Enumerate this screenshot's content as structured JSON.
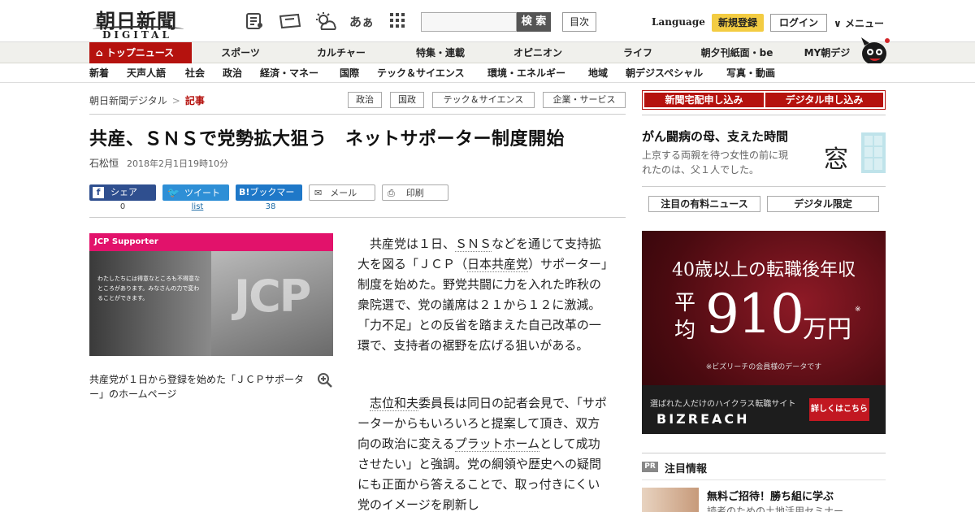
{
  "header": {
    "logo_jp": "朝日新聞",
    "logo_en": "DIGITAL",
    "font_size_label": "あぁ",
    "search_button": "検 索",
    "toc_button": "目次",
    "language": "Language",
    "register": "新規登録",
    "login": "ログイン",
    "menu": "メニュー"
  },
  "nav1": {
    "top": "トップニュース",
    "items": [
      "スポーツ",
      "カルチャー",
      "特集・連載",
      "オピニオン",
      "ライフ",
      "朝夕刊紙面・be",
      "MY朝デジ"
    ]
  },
  "nav2": {
    "items": [
      "新着",
      "天声人語",
      "社会",
      "政治",
      "経済・マネー",
      "国際",
      "テック＆サイエンス",
      "環境・エネルギー",
      "地域",
      "朝デジスペシャル",
      "写真・動画"
    ]
  },
  "breadcrumb": {
    "home": "朝日新聞デジタル",
    "sep": ">",
    "current": "記事"
  },
  "tags": [
    "政治",
    "国政",
    "テック＆サイエンス",
    "企業・サービス"
  ],
  "article": {
    "headline": "共産、ＳＮＳで党勢拡大狙う　ネットサポーター制度開始",
    "author": "石松恒",
    "date": "2018年2月1日19時10分",
    "share": {
      "facebook": "シェア",
      "facebook_count": "0",
      "twitter": "ツイート",
      "twitter_count": "list",
      "hatena": "ブックマーク",
      "hatena_prefix": "B!",
      "hatena_count": "38",
      "mail": "メール",
      "print": "印刷"
    },
    "photo": {
      "brand": "JCP Supporter",
      "big": "JCP",
      "overlay_text": "わたしたちには得意なところも不得意なところがあります。みなさんの力で変わることができます。"
    },
    "caption": "共産党が１日から登録を始めた「ＪＣＰサポーター」のホームページ",
    "p1": {
      "t1": "共産党は１日、",
      "l1": "ＳＮＳ",
      "t2": "などを通じて支持拡大を図る「ＪＣＰ（",
      "l2": "日本共産党",
      "t3": "）サポーター」制度を始めた。野党共闘に力を入れた昨秋の衆院選で、党の議席は２１から１２に激減。「力不足」との反省を踏まえた自己改革の一環で、支持者の裾野を広げる狙いがある。"
    },
    "p2": {
      "l1": "志位和夫",
      "t1": "委員長は同日の記者会見で、「サポーターからもいろいろと提案して頂き、双方向の政治に変える",
      "l2": "プラットホーム",
      "t2": "として成功させたい」と強調。党の綱領や歴史への疑問にも正面から答えることで、取っ付きにくい党のイメージを刷新し"
    }
  },
  "sidebar": {
    "apply_home": "新聞宅配申し込み",
    "apply_digital": "デジタル申し込み",
    "mado_title": "がん闘病の母、支えた時間",
    "mado_desc": "上京する両親を待つ女性の前に現れたのは、父１人でした。",
    "mado_logo": "窓",
    "tab_paid": "注目の有料ニュース",
    "tab_digital": "デジタル限定",
    "ad": {
      "line1": "40歳以上の転職後年収",
      "vert": "平均",
      "number": "910",
      "unit": "万円",
      "note": "※",
      "source": "※ビズリーチの会員様のデータです",
      "tagline": "選ばれた人だけのハイクラス転職サイト",
      "brand": "BIZREACH",
      "cta": "詳しくはこちら"
    },
    "pr_badge": "PR",
    "pr_title": "注目情報",
    "pr_item_title": "無料ご招待！勝ち組に学ぶ",
    "pr_item_desc": "読者のための土地活用セミナー"
  },
  "colors": {
    "brand_red": "#b5120e",
    "register_yellow": "#f3cc42",
    "facebook": "#2f4f8f",
    "twitter": "#2e8fd6",
    "hatena": "#1f78c8"
  }
}
